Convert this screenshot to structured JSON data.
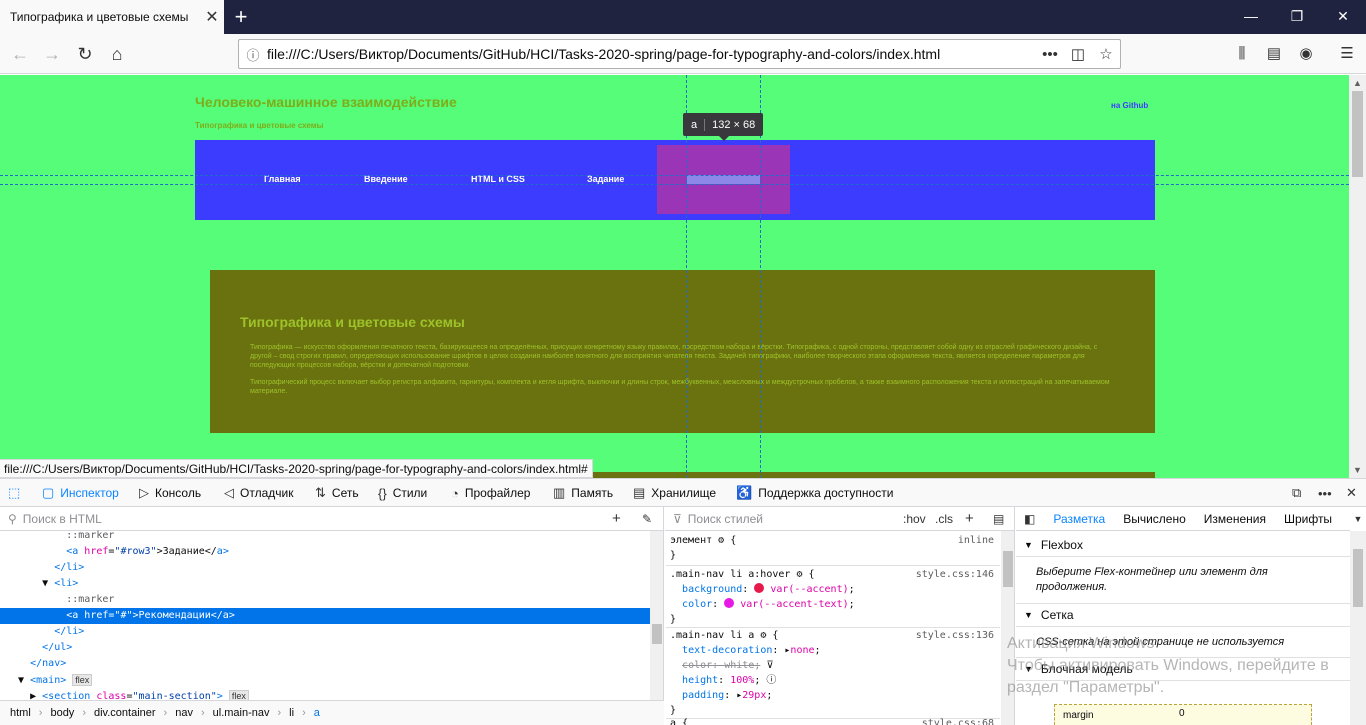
{
  "browser": {
    "tab_title": "Типографика и цветовые схемы",
    "tab_close": "✕",
    "new_tab": "+",
    "window_controls": {
      "minimize": "—",
      "maximize": "❐",
      "close": "✕"
    },
    "url": "file:///C:/Users/Виктор/Documents/GitHub/HCI/Tasks-2020-spring/page-for-typography-and-colors/index.html",
    "status_url": "file:///C:/Users/Виктор/Documents/GitHub/HCI/Tasks-2020-spring/page-for-typography-and-colors/index.html#",
    "icons": {
      "back": "←",
      "forward": "→",
      "reload": "↻",
      "home": "⌂",
      "info": "ⓘ",
      "more": "•••",
      "pocket": "◫",
      "star": "☆",
      "library": "⫼",
      "sidebar": "▤",
      "account": "◉",
      "menu": "☰"
    }
  },
  "page": {
    "site_title": "Человеко-машинное взаимодействие",
    "site_subtitle": "Типографика и цветовые схемы",
    "github_link": "на Github",
    "nav_items": [
      "Главная",
      "Введение",
      "HTML и CSS",
      "Задание"
    ],
    "section_title": "Типографика и цветовые схемы",
    "paragraph_1": "Типографика — искусство оформления печатного текста, базирующееся на определённых, присущих конкретному языку правилах, посредством набора и вёрстки. Типографика, с одной стороны, представляет собой одну из отраслей графического дизайна, с другой – свод строгих правил, определяющих использование шрифтов в целях создания наиболее понятного для восприятия читателя текста. Задачей типографики, наиболее творческого этапа оформления текста, является определение параметров для последующих процессов набора, вёрстки и допечатной подготовки.",
    "paragraph_2": "Типографический процесс включает выбор регистра алфавита, гарнитуры, комплекта и кегля шрифта, выключки и длины строк, межбуквенных, межсловных и междустрочных пробелов, а также взаимного расположения текста и иллюстраций на запечатываемом материале.",
    "tooltip_tag": "a",
    "tooltip_size": "132 × 68"
  },
  "devtools": {
    "tabs": [
      {
        "label": "Инспектор",
        "icon": "▢"
      },
      {
        "label": "Консоль",
        "icon": "▷"
      },
      {
        "label": "Отладчик",
        "icon": "◁"
      },
      {
        "label": "Сеть",
        "icon": "⇅"
      },
      {
        "label": "Стили",
        "icon": "{}"
      },
      {
        "label": "Профайлер",
        "icon": "◔"
      },
      {
        "label": "Память",
        "icon": "▥"
      },
      {
        "label": "Хранилище",
        "icon": "▤"
      },
      {
        "label": "Поддержка доступности",
        "icon": "♿"
      }
    ],
    "html_search_placeholder": "Поиск в HTML",
    "styles_search_placeholder": "Поиск стилей",
    "hov_label": ":hov",
    "cls_label": ".cls",
    "markup": {
      "marker1": "::marker",
      "a1_tag_open": "<a ",
      "a1_attr": "href",
      "a1_val": "\"#row3\"",
      "a1_text": ">Задание</",
      "a1_close": "a>",
      "li_close1": "</li>",
      "li_open": "<li>",
      "marker2": "::marker",
      "a2_tag_open": "<a ",
      "a2_attr": "href",
      "a2_val": "\"#\"",
      "a2_text": ">Рекомендации</",
      "a2_close": "a>",
      "li_close2": "</li>",
      "ul_close": "</ul>",
      "nav_close": "</nav>",
      "main_open": "<main>",
      "main_badge": "flex",
      "section_open": "<section ",
      "section_attr": "class",
      "section_val": "\"main-section\"",
      "section_end": ">",
      "section_badge": "flex"
    },
    "breadcrumbs": [
      "html",
      "body",
      "div.container",
      "nav",
      "ul.main-nav",
      "li",
      "a"
    ],
    "rules": {
      "element_sel": "элемент",
      "element_src": "inline",
      "r1_sel": ".main-nav li a:hover",
      "r1_src": "style.css:146",
      "r1_p1": "background",
      "r1_v1": "var(--accent)",
      "r1_p2": "color",
      "r1_v2": "var(--accent-text)",
      "r2_sel": ".main-nav li a",
      "r2_src": "style.css:136",
      "r2_p1": "text-decoration",
      "r2_v1": "none",
      "r2_p2": "color",
      "r2_v2": "white",
      "r2_p3": "height",
      "r2_v3": "100%",
      "r2_p4": "padding",
      "r2_v4": "29px",
      "r3_sel": "a {",
      "r3_src": "style.css:68"
    },
    "layout_tabs": [
      "Разметка",
      "Вычислено",
      "Изменения",
      "Шрифты"
    ],
    "flexbox_title": "Flexbox",
    "flexbox_body": "Выберите Flex-контейнер или элемент для продолжения.",
    "grid_title": "Сетка",
    "grid_body": "CSS-сетка на этой странице не используется",
    "box_title": "Блочная модель",
    "box_margin_label": "margin",
    "box_margin_value": "0",
    "watermark_1": "Активация Windows",
    "watermark_2": "Чтобы активировать Windows, перейдите в",
    "watermark_3": "раздел \"Параметры\"."
  },
  "colors": {
    "page_bg": "#56fd78",
    "nav_bg": "#3c3cff",
    "section_bg": "#6a720f",
    "accent_swatch": "#e6194b",
    "accent_text_swatch": "#e619e6"
  }
}
